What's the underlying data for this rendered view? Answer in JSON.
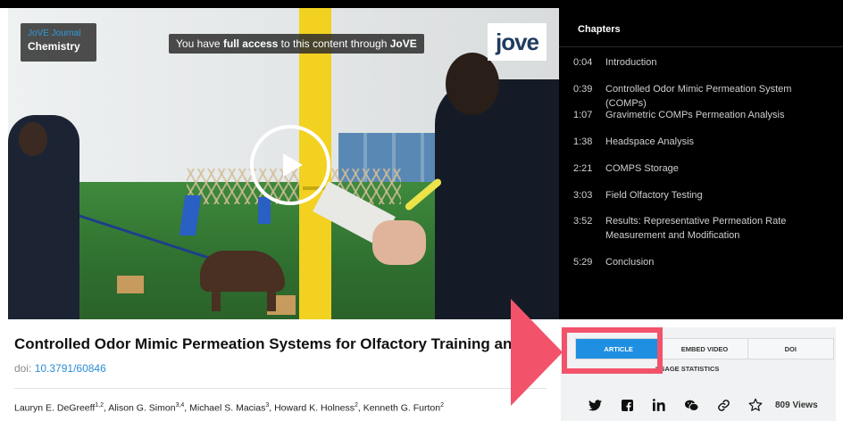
{
  "video": {
    "journal_label": "JoVE Journal",
    "section_label": "Chemistry",
    "access_prefix": "You have ",
    "access_bold": "full access",
    "access_suffix": " to this content through ",
    "access_institution": "JoVE",
    "logo_text": "jove"
  },
  "chapters": {
    "title": "Chapters",
    "items": [
      {
        "time": "0:04",
        "label": "Introduction"
      },
      {
        "time": "0:39",
        "label": "Controlled Odor Mimic Permeation System (COMPs)"
      },
      {
        "time": "1:07",
        "label": "Gravimetric COMPs Permeation Analysis"
      },
      {
        "time": "1:38",
        "label": "Headspace Analysis"
      },
      {
        "time": "2:21",
        "label": "COMPS Storage"
      },
      {
        "time": "3:03",
        "label": "Field Olfactory Testing"
      },
      {
        "time": "3:52",
        "label": "Results: Representative Permeation Rate Measurement and Modification"
      },
      {
        "time": "5:29",
        "label": "Conclusion"
      }
    ]
  },
  "article": {
    "title": "Controlled Odor Mimic Permeation Systems for Olfactory Training and Field Te",
    "doi_label": "doi:",
    "doi_value": "10.3791/60846",
    "authors": [
      {
        "name": "Lauryn E. DeGreeff",
        "aff": "1,2"
      },
      {
        "name": "Alison G. Simon",
        "aff": "3,4"
      },
      {
        "name": "Michael S. Macias",
        "aff": "3"
      },
      {
        "name": "Howard K. Holness",
        "aff": "2"
      },
      {
        "name": "Kenneth G. Furton",
        "aff": "2"
      }
    ]
  },
  "panel": {
    "tab_article": "ARTICLE",
    "tab_embed": "EMBED VIDEO",
    "tab_doi": "DOI",
    "usage": "USAGE STATISTICS",
    "views": "809 Views"
  },
  "icons": {
    "twitter": "ᵡ",
    "facebook": "f",
    "linkedin": "in",
    "wechat": "☁",
    "link": "⚭",
    "star": "☆"
  },
  "colors": {
    "accent": "#1e8fe1",
    "highlight": "#f2536b",
    "link": "#2a8fd4"
  }
}
